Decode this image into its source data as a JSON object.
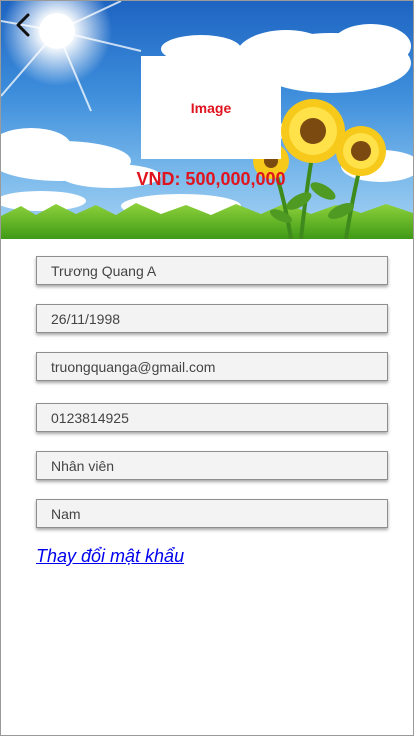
{
  "header": {
    "image_placeholder_label": "Image",
    "price_text": "VND: 500,000,000"
  },
  "profile": {
    "fields": [
      {
        "value": "Trương Quang A"
      },
      {
        "value": "26/11/1998"
      },
      {
        "value": "truongquanga@gmail.com"
      },
      {
        "value": "0123814925"
      },
      {
        "value": "Nhân viên"
      },
      {
        "value": "Nam"
      }
    ],
    "change_password_label": "Thay đổi mật khẩu"
  },
  "icons": {
    "back": "chevron-left-icon"
  },
  "colors": {
    "price": "#e0141e",
    "link": "#0000ee",
    "field_bg": "#f3f3f3"
  }
}
